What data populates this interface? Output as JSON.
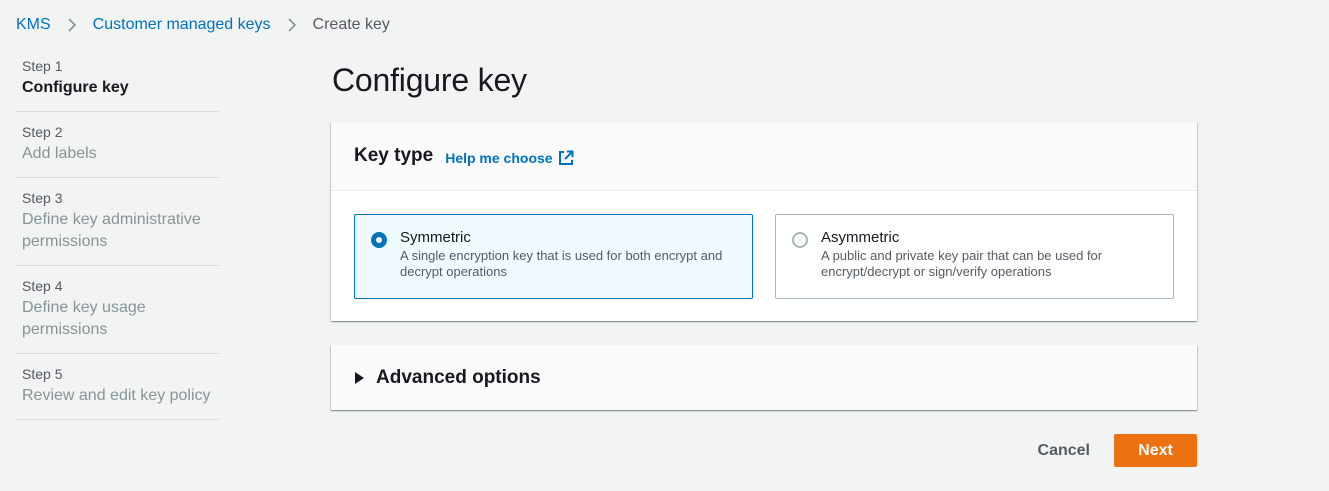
{
  "breadcrumb": {
    "items": [
      "KMS",
      "Customer managed keys"
    ],
    "current": "Create key"
  },
  "steps": [
    {
      "number": "Step 1",
      "title": "Configure key",
      "active": true
    },
    {
      "number": "Step 2",
      "title": "Add labels",
      "active": false
    },
    {
      "number": "Step 3",
      "title": "Define key administrative permissions",
      "active": false
    },
    {
      "number": "Step 4",
      "title": "Define key usage permissions",
      "active": false
    },
    {
      "number": "Step 5",
      "title": "Review and edit key policy",
      "active": false
    }
  ],
  "page_title": "Configure key",
  "key_type": {
    "title": "Key type",
    "help_link": "Help me choose",
    "options": [
      {
        "label": "Symmetric",
        "description": "A single encryption key that is used for both encrypt and decrypt operations",
        "selected": true
      },
      {
        "label": "Asymmetric",
        "description": "A public and private key pair that can be used for encrypt/decrypt or sign/verify operations",
        "selected": false
      }
    ]
  },
  "advanced": {
    "label": "Advanced options",
    "expanded": false
  },
  "actions": {
    "cancel_label": "Cancel",
    "next_label": "Next"
  },
  "colors": {
    "link": "#0073bb",
    "primary_button": "#ec7211",
    "selected_tile_bg": "#f1faff",
    "background": "#f2f3f3"
  }
}
